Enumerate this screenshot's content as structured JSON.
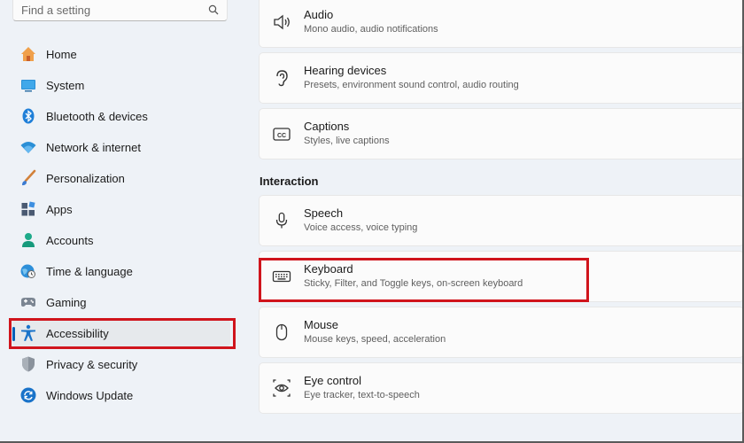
{
  "search": {
    "placeholder": "Find a setting",
    "icon": "search-icon"
  },
  "sidebar": {
    "items": [
      {
        "label": "Home",
        "icon": "home-icon"
      },
      {
        "label": "System",
        "icon": "system-monitor-icon"
      },
      {
        "label": "Bluetooth & devices",
        "icon": "bluetooth-icon"
      },
      {
        "label": "Network & internet",
        "icon": "wifi-icon"
      },
      {
        "label": "Personalization",
        "icon": "brush-icon"
      },
      {
        "label": "Apps",
        "icon": "apps-icon"
      },
      {
        "label": "Accounts",
        "icon": "account-icon"
      },
      {
        "label": "Time & language",
        "icon": "globe-clock-icon"
      },
      {
        "label": "Gaming",
        "icon": "gamepad-icon"
      },
      {
        "label": "Accessibility",
        "icon": "accessibility-icon",
        "selected": true
      },
      {
        "label": "Privacy & security",
        "icon": "shield-icon"
      },
      {
        "label": "Windows Update",
        "icon": "update-icon"
      }
    ]
  },
  "main": {
    "hearing_cards": [
      {
        "title": "Audio",
        "subtitle": "Mono audio, audio notifications",
        "icon": "speaker-icon"
      },
      {
        "title": "Hearing devices",
        "subtitle": "Presets, environment sound control, audio routing",
        "icon": "ear-icon"
      },
      {
        "title": "Captions",
        "subtitle": "Styles, live captions",
        "icon": "captions-icon"
      }
    ],
    "interaction_title": "Interaction",
    "interaction_cards": [
      {
        "title": "Speech",
        "subtitle": "Voice access, voice typing",
        "icon": "microphone-icon"
      },
      {
        "title": "Keyboard",
        "subtitle": "Sticky, Filter, and Toggle keys, on-screen keyboard",
        "icon": "keyboard-icon",
        "highlighted": true
      },
      {
        "title": "Mouse",
        "subtitle": "Mouse keys, speed, acceleration",
        "icon": "mouse-icon"
      },
      {
        "title": "Eye control",
        "subtitle": "Eye tracker, text-to-speech",
        "icon": "eye-control-icon"
      }
    ]
  },
  "colors": {
    "accent": "#005fb8",
    "highlight_box": "#d0141c"
  }
}
